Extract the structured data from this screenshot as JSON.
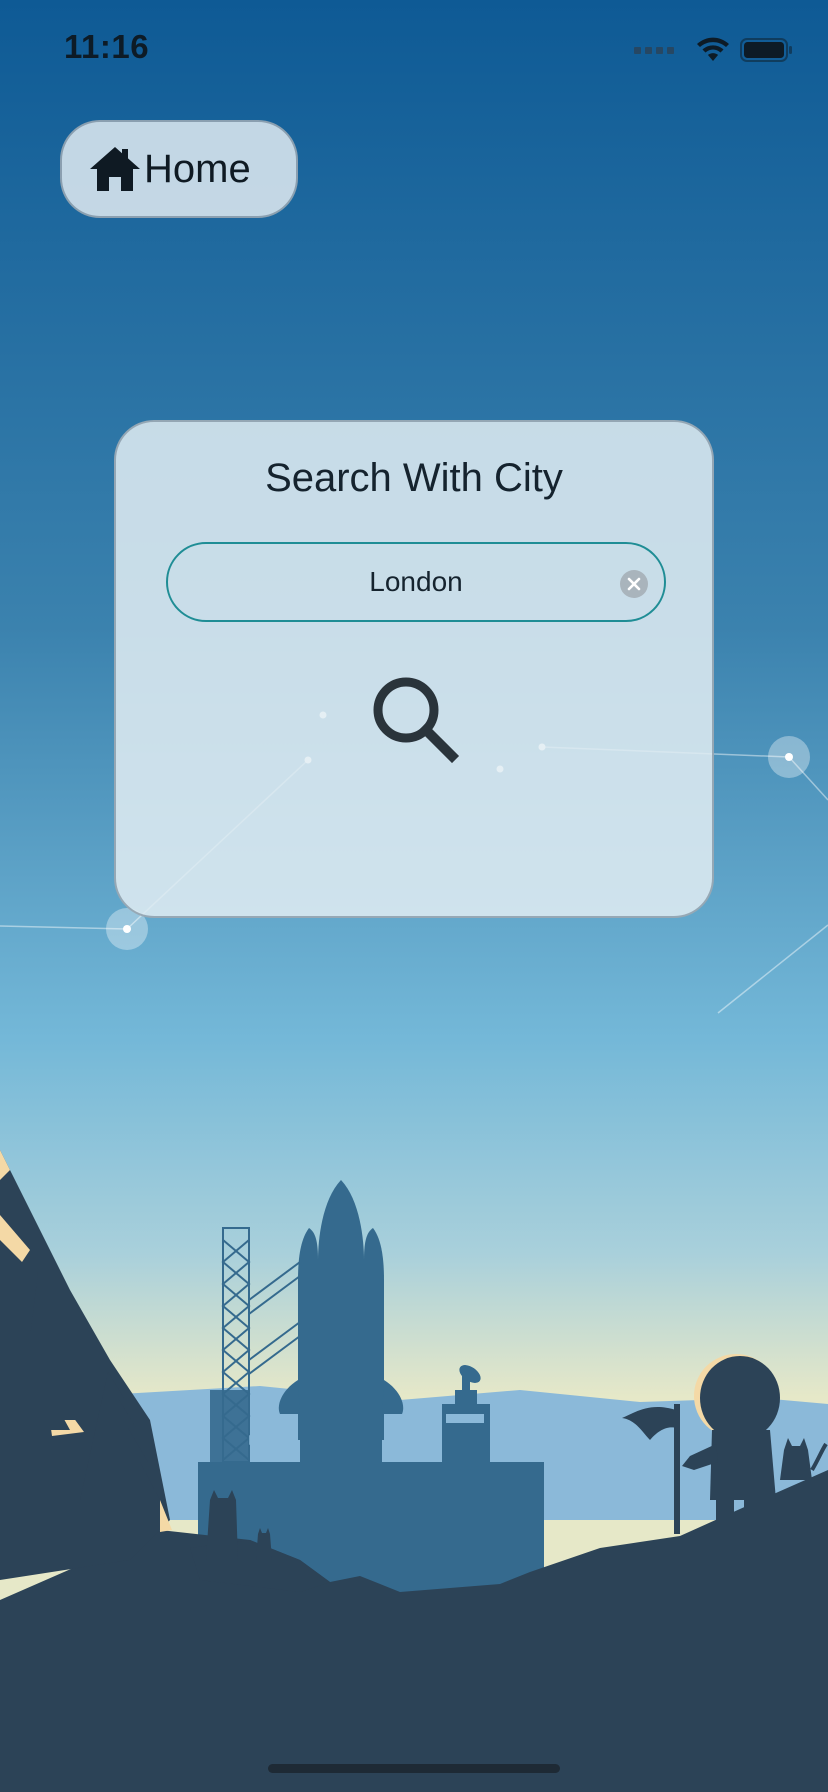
{
  "status_bar": {
    "time": "11:16"
  },
  "nav": {
    "home_label": "Home",
    "home_icon": "house-icon"
  },
  "search_card": {
    "title": "Search With City",
    "input_value": "London",
    "clear_icon": "clear-circle-icon",
    "search_icon": "magnifier-icon"
  },
  "colors": {
    "sky_top": "#0e5a95",
    "sky_mid": "#74b8d8",
    "horizon": "#e6e8c8",
    "silhouette_dark": "#2c4357",
    "silhouette_mid": "#356a8e",
    "field_border": "#1f8d95",
    "card_bg": "#e1ecf2"
  }
}
